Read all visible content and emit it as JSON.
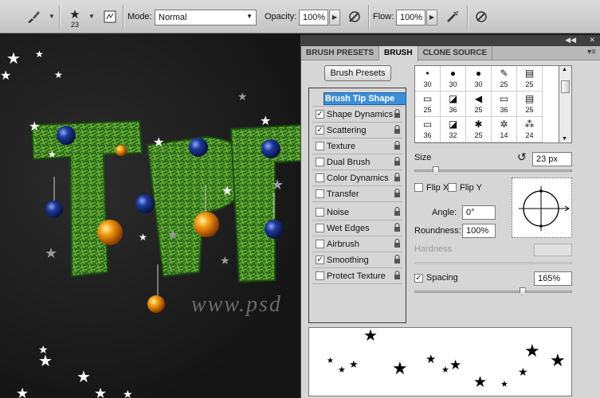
{
  "options_bar": {
    "brush_size": "23",
    "mode_label": "Mode:",
    "mode_value": "Normal",
    "opacity_label": "Opacity:",
    "opacity_value": "100%",
    "flow_label": "Flow:",
    "flow_value": "100%"
  },
  "canvas": {
    "watermark": "www.psd"
  },
  "panel": {
    "tabs": [
      "BRUSH PRESETS",
      "BRUSH",
      "CLONE SOURCE"
    ],
    "active_tab": "BRUSH",
    "presets_button": "Brush Presets",
    "options": [
      {
        "label": "Brush Tip Shape",
        "checked": null,
        "head": true
      },
      {
        "label": "Shape Dynamics",
        "checked": true
      },
      {
        "label": "Scattering",
        "checked": true
      },
      {
        "label": "Texture",
        "checked": false
      },
      {
        "label": "Dual Brush",
        "checked": false
      },
      {
        "label": "Color Dynamics",
        "checked": false
      },
      {
        "label": "Transfer",
        "checked": false
      },
      {
        "label": "Noise",
        "checked": false
      },
      {
        "label": "Wet Edges",
        "checked": false
      },
      {
        "label": "Airbrush",
        "checked": false
      },
      {
        "label": "Smoothing",
        "checked": true
      },
      {
        "label": "Protect Texture",
        "checked": false
      }
    ],
    "brush_tips": [
      {
        "n": "30",
        "g": "•"
      },
      {
        "n": "30",
        "g": "●"
      },
      {
        "n": "30",
        "g": "●"
      },
      {
        "n": "25",
        "g": "✎"
      },
      {
        "n": "25",
        "g": "▤"
      },
      {
        "n": "25",
        "g": "▭"
      },
      {
        "n": "36",
        "g": "◪"
      },
      {
        "n": "25",
        "g": "◀"
      },
      {
        "n": "36",
        "g": "▭"
      },
      {
        "n": "25",
        "g": "▤"
      },
      {
        "n": "36",
        "g": "▭"
      },
      {
        "n": "32",
        "g": "◪"
      },
      {
        "n": "25",
        "g": "✱"
      },
      {
        "n": "14",
        "g": "✲"
      },
      {
        "n": "24",
        "g": "⁂"
      }
    ],
    "size_label": "Size",
    "size_value": "23 px",
    "flip_x": "Flip X",
    "flip_y": "Flip Y",
    "angle_label": "Angle:",
    "angle_value": "0°",
    "roundness_label": "Roundness:",
    "roundness_value": "100%",
    "hardness_label": "Hardness",
    "spacing_label": "Spacing",
    "spacing_value": "165%",
    "size_slider_level": 0.04,
    "spacing_slider_level": 0.66
  },
  "colors": {
    "selection_blue": "#3f8ed8",
    "panel_bg": "#d6d6d6",
    "canvas_bg": "#1e1e1e"
  }
}
